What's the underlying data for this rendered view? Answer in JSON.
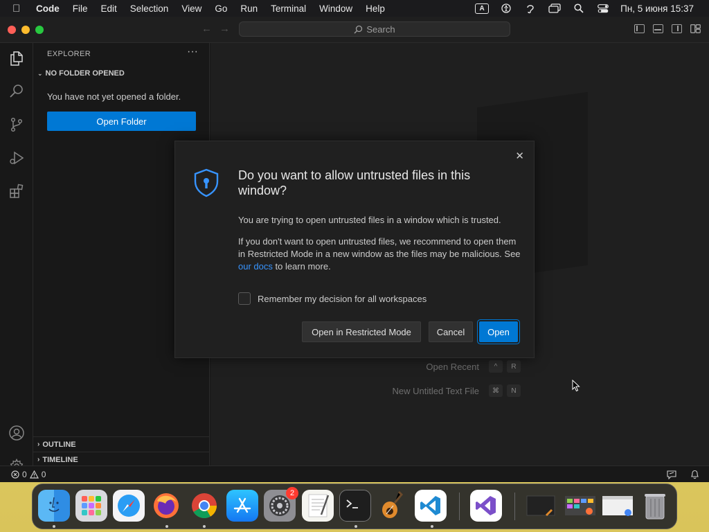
{
  "menubar": {
    "app_name": "Code",
    "items": [
      "File",
      "Edit",
      "Selection",
      "View",
      "Go",
      "Run",
      "Terminal",
      "Window",
      "Help"
    ],
    "input_source": "A",
    "datetime": "Пн, 5 июня  15:37"
  },
  "titlebar": {
    "search_placeholder": "Search"
  },
  "sidebar": {
    "title": "EXPLORER",
    "more": "···",
    "section": "NO FOLDER OPENED",
    "message": "You have not yet opened a folder.",
    "open_folder_label": "Open Folder",
    "outline_label": "OUTLINE",
    "timeline_label": "TIMELINE"
  },
  "editor": {
    "open_recent_label": "Open Recent",
    "open_recent_keys": [
      "^",
      "R"
    ],
    "new_file_label": "New Untitled Text File",
    "new_file_keys": [
      "⌘",
      "N"
    ]
  },
  "statusbar": {
    "errors": "0",
    "warnings": "0"
  },
  "dialog": {
    "title": "Do you want to allow untrusted files in this window?",
    "message1": "You are trying to open untrusted files in a window which is trusted.",
    "message2_before": "If you don't want to open untrusted files, we recommend to open them in Restricted Mode in a new window as the files may be malicious. See ",
    "message2_link": "our docs",
    "message2_after": " to learn more.",
    "checkbox_label": "Remember my decision for all workspaces",
    "checkbox_checked": false,
    "btn_restricted": "Open in Restricted Mode",
    "btn_cancel": "Cancel",
    "btn_open": "Open"
  },
  "dock": {
    "apps": [
      "finder",
      "launchpad",
      "safari",
      "firefox",
      "chrome",
      "app-store",
      "system-settings",
      "textedit",
      "terminal",
      "garageband",
      "vscode",
      "visual-studio"
    ],
    "system_settings_badge": "2"
  },
  "colors": {
    "accent": "#0078d4",
    "link": "#3794ff",
    "editor_bg": "#1f1f1f",
    "sidebar_bg": "#181818"
  }
}
